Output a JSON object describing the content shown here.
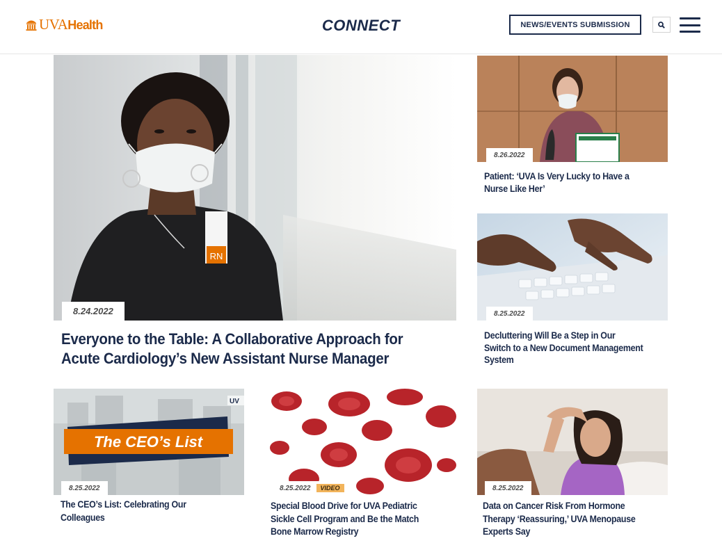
{
  "header": {
    "logo_text_a": "UVA",
    "logo_text_b": "Health",
    "site_title": "CONNECT",
    "submit_button": "NEWS/EVENTS SUBMISSION",
    "search_icon": "search-icon",
    "menu_icon": "hamburger-menu-icon"
  },
  "colors": {
    "navy": "#1b2a4a",
    "orange": "#e57200",
    "video_badge": "#f2b45b"
  },
  "featured": {
    "date": "8.24.2022",
    "headline": "Everyone to the Table: A Collaborative Approach for Acute Cardiology’s New Assistant Nurse Manager",
    "badge_text": "RN"
  },
  "side_stories": [
    {
      "date": "8.26.2022",
      "headline": "Patient: ‘UVA Is Very Lucky to Have a Nurse Like Her’"
    },
    {
      "date": "8.25.2022",
      "headline": "Decluttering Will Be a Step in Our Switch to a New Document Management System"
    }
  ],
  "bottom_stories": [
    {
      "date": "8.25.2022",
      "headline": "The CEO’s List: Celebrating Our Colleagues",
      "image_banner": "The CEO’s List",
      "image_corner_logo": "UV"
    },
    {
      "date": "8.25.2022",
      "badge": "VIDEO",
      "headline": "Special Blood Drive for UVA Pediatric Sickle Cell Program and Be the Match Bone Marrow Registry"
    },
    {
      "date": "8.25.2022",
      "headline": "Data on Cancer Risk From Hormone Therapy ‘Reassuring,’ UVA Menopause Experts Say"
    }
  ]
}
